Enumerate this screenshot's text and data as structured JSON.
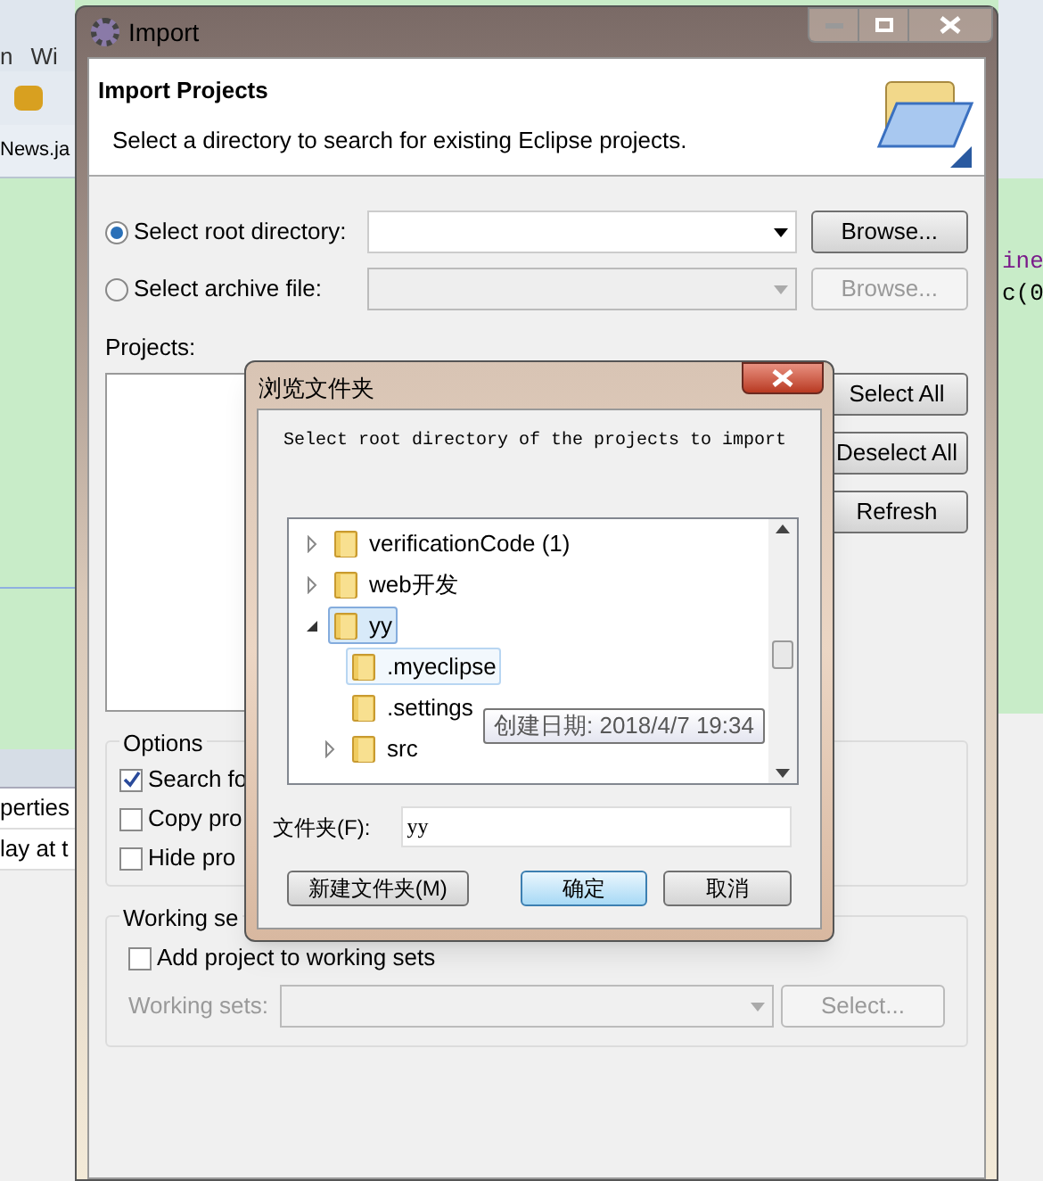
{
  "background_ide": {
    "menu_items": [
      "n",
      "Wi"
    ],
    "editor_tab": "News.ja",
    "left_texts": [
      "perties",
      "lay at t"
    ],
    "code_fragments": [
      "ine",
      "c(0"
    ]
  },
  "window": {
    "title": "Import"
  },
  "header": {
    "title": "Import Projects",
    "description": "Select a directory to search for existing Eclipse projects."
  },
  "source": [
    {
      "label": "Select root directory:",
      "selected": true,
      "button": "Browse..."
    },
    {
      "label": "Select archive file:",
      "selected": false,
      "button": "Browse..."
    }
  ],
  "projects": {
    "label": "Projects:",
    "buttons": [
      "Select All",
      "Deselect All",
      "Refresh"
    ]
  },
  "options": {
    "title": "Options",
    "items": [
      {
        "label": "Search fo",
        "checked": true
      },
      {
        "label": "Copy pro",
        "checked": false
      },
      {
        "label": "Hide pro",
        "checked": false
      }
    ]
  },
  "working_sets": {
    "title": "Working se",
    "add": {
      "label": "Add project to working sets",
      "checked": false
    },
    "field_label": "Working sets:",
    "button": "Select..."
  },
  "folder_dialog": {
    "title": "浏览文件夹",
    "prompt": "Select root directory of the projects to import",
    "tree": [
      {
        "label": "verificationCode (1)",
        "expanded": false,
        "selected": false
      },
      {
        "label": "web开发",
        "expanded": false,
        "selected": false
      },
      {
        "label": "yy",
        "expanded": true,
        "selected": true,
        "children": [
          {
            "label": ".myeclipse",
            "expandable": false,
            "hovered": true
          },
          {
            "label": ".settings",
            "expandable": false,
            "hovered": false
          },
          {
            "label": "src",
            "expandable": true,
            "hovered": false
          }
        ]
      }
    ],
    "tooltip": "创建日期: 2018/4/7 19:34",
    "folder_label": "文件夹(F):",
    "folder_value": "yy",
    "buttons": [
      {
        "label": "新建文件夹(M)",
        "default": false
      },
      {
        "label": "确定",
        "default": true
      },
      {
        "label": "取消",
        "default": false
      }
    ]
  }
}
